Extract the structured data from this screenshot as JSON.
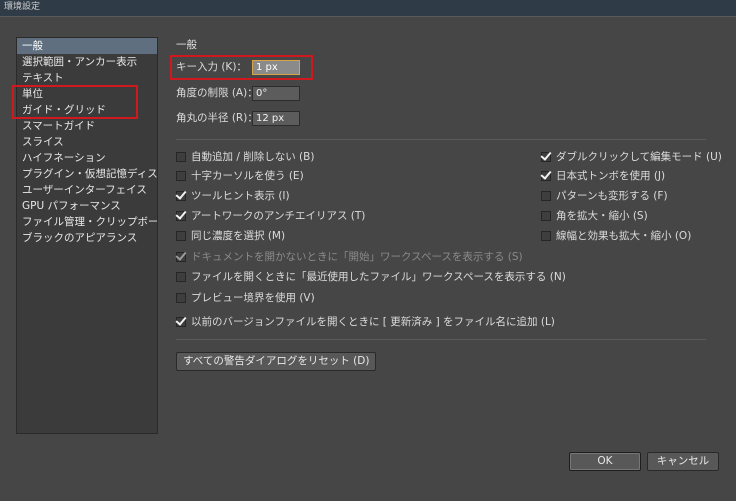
{
  "window": {
    "title": "環境設定"
  },
  "sidebar": {
    "items": [
      {
        "label": "一般",
        "selected": true
      },
      {
        "label": "選択範囲・アンカー表示"
      },
      {
        "label": "テキスト"
      },
      {
        "label": "単位"
      },
      {
        "label": "ガイド・グリッド"
      },
      {
        "label": "スマートガイド"
      },
      {
        "label": "スライス"
      },
      {
        "label": "ハイフネーション"
      },
      {
        "label": "プラグイン・仮想記憶ディスク"
      },
      {
        "label": "ユーザーインターフェイス"
      },
      {
        "label": "GPU パフォーマンス"
      },
      {
        "label": "ファイル管理・クリップボード"
      },
      {
        "label": "ブラックのアピアランス"
      }
    ]
  },
  "general": {
    "section_title": "一般",
    "key_input": {
      "label": "キー入力 (K)：",
      "value": "1 px"
    },
    "angle": {
      "label": "角度の制限 (A)：",
      "value": "0°"
    },
    "corner_radius": {
      "label": "角丸の半径 (R)：",
      "value": "12 px"
    },
    "options_left": [
      {
        "label": "自動追加 / 削除しない (B)",
        "checked": false
      },
      {
        "label": "十字カーソルを使う (E)",
        "checked": false
      },
      {
        "label": "ツールヒント表示 (I)",
        "checked": true
      },
      {
        "label": "アートワークのアンチエイリアス (T)",
        "checked": true
      },
      {
        "label": "同じ濃度を選択 (M)",
        "checked": false
      }
    ],
    "options_right": [
      {
        "label": "ダブルクリックして編集モード (U)",
        "checked": true
      },
      {
        "label": "日本式トンボを使用 (J)",
        "checked": true
      },
      {
        "label": "パターンも変形する (F)",
        "checked": false
      },
      {
        "label": "角を拡大・縮小 (S)",
        "checked": false
      },
      {
        "label": "線幅と効果も拡大・縮小 (O)",
        "checked": false
      }
    ],
    "options_full": [
      {
        "label": "ドキュメントを開かないときに「開始」ワークスペースを表示する (S)",
        "checked": true,
        "disabled": true
      },
      {
        "label": "ファイルを開くときに「最近使用したファイル」ワークスペースを表示する (N)",
        "checked": false
      },
      {
        "label": "プレビュー境界を使用 (V)",
        "checked": false
      },
      {
        "label": "以前のバージョンファイルを開くときに [ 更新済み ] をファイル名に追加 (L)",
        "checked": true
      }
    ],
    "reset_button": "すべての警告ダイアログをリセット (D)"
  },
  "footer": {
    "ok": "OK",
    "cancel": "キャンセル"
  },
  "colors": {
    "highlight": "#d0191f",
    "selected": "#5f6f80"
  }
}
